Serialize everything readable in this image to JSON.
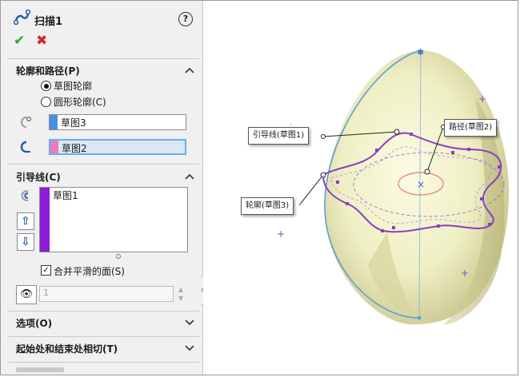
{
  "feature": {
    "title": "扫描1"
  },
  "sections": {
    "profile_path": {
      "header": "轮廓和路径(P)",
      "radio_sketch": "草图轮廓",
      "radio_circular": "圆形轮廓(C)",
      "profile_field": "草图3",
      "path_field": "草图2"
    },
    "guide_curves": {
      "header": "引导线(C)",
      "list_items": [
        "草图1"
      ],
      "merge_smooth": "合并平滑的面(S)",
      "spin_value": "1"
    },
    "options": {
      "header": "选项(O)"
    },
    "tangency": {
      "header": "起始处和结束处相切(T)"
    }
  },
  "viewport": {
    "callouts": {
      "guide": "引导线(草图1)",
      "path": "路径(草图2)",
      "profile": "轮廓(草图3)"
    }
  },
  "colors": {
    "accent_blue": "#66aef0",
    "profile_swatch": "#4a90e2",
    "path_swatch": "#e87fb8",
    "guide_swatch": "#8b1ed8",
    "body_fill": "#efefc4",
    "sketch_purple": "#8b3fbf"
  }
}
